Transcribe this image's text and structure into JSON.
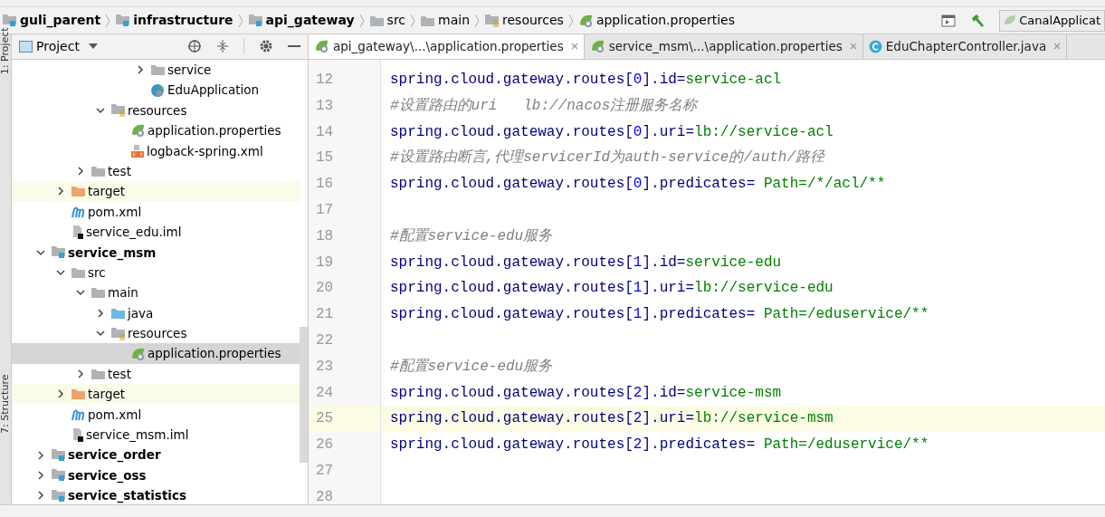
{
  "breadcrumb": [
    {
      "label": "guli_parent",
      "kind": "module"
    },
    {
      "label": "infrastructure",
      "kind": "module"
    },
    {
      "label": "api_gateway",
      "kind": "module"
    },
    {
      "label": "src",
      "kind": "folder"
    },
    {
      "label": "main",
      "kind": "folder"
    },
    {
      "label": "resources",
      "kind": "resources"
    },
    {
      "label": "application.properties",
      "kind": "spring"
    }
  ],
  "run_config": {
    "label": "CanalApplicat"
  },
  "side_strip": [
    "1: Project",
    "7: Structure"
  ],
  "project_panel": {
    "title": "Project",
    "tree": [
      {
        "children": [
          {
            "children": [
              {
                "children": [
                  {
                    "children": [
                      {
                        "children": [
                          {
                            "label": "service",
                            "kind": "folder",
                            "expanded": false,
                            "selected": false,
                            "ignored": false
                          },
                          {
                            "label": "EduApplication",
                            "kind": "app",
                            "selected": false,
                            "ignored": false
                          }
                        ]
                      }
                    ]
                  },
                  {
                    "label": "resources",
                    "kind": "resources",
                    "expanded": true,
                    "selected": false,
                    "ignored": false,
                    "children": [
                      {
                        "label": "application.properties",
                        "kind": "spring",
                        "selected": false,
                        "ignored": false
                      },
                      {
                        "label": "logback-spring.xml",
                        "kind": "xml",
                        "selected": false,
                        "ignored": false
                      }
                    ]
                  }
                ]
              },
              {
                "label": "test",
                "kind": "folder",
                "expanded": false,
                "selected": false,
                "ignored": false
              }
            ]
          },
          {
            "label": "target",
            "kind": "target",
            "expanded": false,
            "selected": false,
            "ignored": true
          },
          {
            "label": "pom.xml",
            "kind": "maven",
            "selected": false,
            "ignored": false
          },
          {
            "label": "service_edu.iml",
            "kind": "iml",
            "selected": false,
            "ignored": false
          }
        ]
      },
      {
        "label": "service_msm",
        "kind": "module",
        "expanded": true,
        "selected": false,
        "ignored": false,
        "children": [
          {
            "label": "src",
            "kind": "folder",
            "expanded": true,
            "selected": false,
            "ignored": false,
            "children": [
              {
                "label": "main",
                "kind": "folder",
                "expanded": true,
                "selected": false,
                "ignored": false,
                "children": [
                  {
                    "label": "java",
                    "kind": "source",
                    "expanded": false,
                    "selected": false,
                    "ignored": false
                  },
                  {
                    "label": "resources",
                    "kind": "resources",
                    "expanded": true,
                    "selected": false,
                    "ignored": false,
                    "children": [
                      {
                        "label": "application.properties",
                        "kind": "spring",
                        "selected": true,
                        "ignored": false
                      }
                    ]
                  }
                ]
              },
              {
                "label": "test",
                "kind": "folder",
                "expanded": false,
                "selected": false,
                "ignored": false
              }
            ]
          },
          {
            "label": "target",
            "kind": "target",
            "expanded": false,
            "selected": false,
            "ignored": true
          },
          {
            "label": "pom.xml",
            "kind": "maven",
            "selected": false,
            "ignored": false
          },
          {
            "label": "service_msm.iml",
            "kind": "iml",
            "selected": false,
            "ignored": false
          }
        ]
      },
      {
        "label": "service_order",
        "kind": "module",
        "expanded": false,
        "selected": false,
        "ignored": false
      },
      {
        "label": "service_oss",
        "kind": "module",
        "expanded": false,
        "selected": false,
        "ignored": false
      },
      {
        "label": "service_statistics",
        "kind": "module",
        "expanded": false,
        "selected": false,
        "ignored": false
      }
    ]
  },
  "editor_tabs": [
    {
      "label": "api_gateway\\...\\application.properties",
      "kind": "spring",
      "selected": true
    },
    {
      "label": "service_msm\\...\\application.properties",
      "kind": "spring",
      "selected": false
    },
    {
      "label": "EduChapterController.java",
      "kind": "class",
      "selected": false
    }
  ],
  "editor": {
    "lines": [
      {
        "number": "12",
        "current": false,
        "tokens": [
          {
            "kind": "key",
            "text": "spring.cloud.gateway.routes["
          },
          {
            "kind": "index",
            "text": "0"
          },
          {
            "kind": "key",
            "text": "].id="
          },
          {
            "kind": "value",
            "text": "service-acl"
          }
        ]
      },
      {
        "number": "13",
        "current": false,
        "tokens": [
          {
            "kind": "comment",
            "text": "#设置路由的uri   lb://nacos注册服务名称"
          }
        ]
      },
      {
        "number": "14",
        "current": false,
        "tokens": [
          {
            "kind": "key",
            "text": "spring.cloud.gateway.routes["
          },
          {
            "kind": "index",
            "text": "0"
          },
          {
            "kind": "key",
            "text": "].uri="
          },
          {
            "kind": "value",
            "text": "lb://service-acl"
          }
        ]
      },
      {
        "number": "15",
        "current": false,
        "tokens": [
          {
            "kind": "comment",
            "text": "#设置路由断言,代理servicerId为auth-service的/auth/路径"
          }
        ]
      },
      {
        "number": "16",
        "current": false,
        "tokens": [
          {
            "kind": "key",
            "text": "spring.cloud.gateway.routes["
          },
          {
            "kind": "index",
            "text": "0"
          },
          {
            "kind": "key",
            "text": "].predicates= "
          },
          {
            "kind": "value",
            "text": "Path=/*/acl/**"
          }
        ]
      },
      {
        "number": "17",
        "current": false
      },
      {
        "number": "18",
        "current": false,
        "tokens": [
          {
            "kind": "comment",
            "text": "#配置service-edu服务"
          }
        ]
      },
      {
        "number": "19",
        "current": false,
        "tokens": [
          {
            "kind": "key",
            "text": "spring.cloud.gateway.routes["
          },
          {
            "kind": "index",
            "text": "1"
          },
          {
            "kind": "key",
            "text": "].id="
          },
          {
            "kind": "value",
            "text": "service-edu"
          }
        ]
      },
      {
        "number": "20",
        "current": false,
        "tokens": [
          {
            "kind": "key",
            "text": "spring.cloud.gateway.routes["
          },
          {
            "kind": "index",
            "text": "1"
          },
          {
            "kind": "key",
            "text": "].uri="
          },
          {
            "kind": "value",
            "text": "lb://service-edu"
          }
        ]
      },
      {
        "number": "21",
        "current": false,
        "tokens": [
          {
            "kind": "key",
            "text": "spring.cloud.gateway.routes["
          },
          {
            "kind": "index",
            "text": "1"
          },
          {
            "kind": "key",
            "text": "].predicates= "
          },
          {
            "kind": "value",
            "text": "Path=/eduservice/**"
          }
        ]
      },
      {
        "number": "22",
        "current": false
      },
      {
        "number": "23",
        "current": false,
        "tokens": [
          {
            "kind": "comment",
            "text": "#配置service-edu服务"
          }
        ]
      },
      {
        "number": "24",
        "current": false,
        "tokens": [
          {
            "kind": "key",
            "text": "spring.cloud.gateway.routes["
          },
          {
            "kind": "index",
            "text": "2"
          },
          {
            "kind": "key",
            "text": "].id="
          },
          {
            "kind": "value",
            "text": "service-msm"
          }
        ]
      },
      {
        "number": "25",
        "current": true,
        "tokens": [
          {
            "kind": "key",
            "text": "spring.cloud.gateway.routes["
          },
          {
            "kind": "index",
            "text": "2"
          },
          {
            "kind": "key",
            "text": "].uri="
          },
          {
            "kind": "value",
            "text": "lb://service-msm"
          }
        ]
      },
      {
        "number": "26",
        "current": false,
        "tokens": [
          {
            "kind": "key",
            "text": "spring.cloud.gateway.routes["
          },
          {
            "kind": "index",
            "text": "2"
          },
          {
            "kind": "key",
            "text": "].predicates= "
          },
          {
            "kind": "value",
            "text": "Path=/eduservice/**"
          }
        ]
      },
      {
        "number": "27",
        "current": false
      },
      {
        "number": "28",
        "current": false
      }
    ]
  }
}
